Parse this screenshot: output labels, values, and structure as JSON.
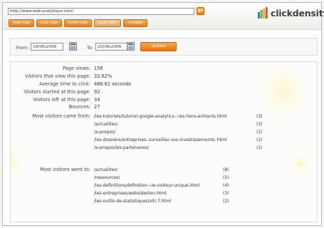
{
  "header": {
    "url": "http://www.web-analytique.com/",
    "go_label": "go",
    "tabs": [
      "heat map",
      "click map",
      "hover map",
      "page stats",
      "navigate"
    ],
    "active_tab_index": 3,
    "logo_text": "clickdensity"
  },
  "date_range": {
    "from_label": "From:",
    "from_value": "18/06/2006",
    "to_label": "To:",
    "to_value": "20/06/2006",
    "update_label": "update"
  },
  "stats": [
    {
      "label": "Page views:",
      "value": "156"
    },
    {
      "label": "Visitors that view this page:",
      "value": "32.62%"
    },
    {
      "label": "Average time to click:",
      "value": "466.61 seconds"
    },
    {
      "label": "Visitors started at this page:",
      "value": "92"
    },
    {
      "label": "Visitors left at this page:",
      "value": "34"
    },
    {
      "label": "Bounces:",
      "value": "27"
    }
  ],
  "came_from": {
    "label": "Most visitors came from:",
    "items": [
      {
        "path": "/les-tutoriels/tutoriel-google-analytics-:-les-liens-entrants.html",
        "count": "(3)"
      },
      {
        "path": "/actualites/",
        "count": "(3)"
      },
      {
        "path": "/a-propos/",
        "count": "(1)"
      },
      {
        "path": "/les-dossiers/entreprises,-surveillez-vos-investissements-.html",
        "count": "(1)"
      },
      {
        "path": "/a-propos/les-partenaires/",
        "count": "(1)"
      }
    ]
  },
  "went_to": {
    "label": "Most visitors went to:",
    "items": [
      {
        "path": "/actualites/",
        "count": "(8)"
      },
      {
        "path": "/ressources/",
        "count": "(5)"
      },
      {
        "path": "/les-definitions/definition-:-le-visiteur-unique.html",
        "count": "(4)"
      },
      {
        "path": "/les-entreprises/websideston.html",
        "count": "(3)"
      },
      {
        "path": "/les-outils-de-statistiques/xiti-7.html",
        "count": "(2)"
      }
    ]
  },
  "colors": {
    "accent": "#ef8416",
    "logo_stripes": [
      "#3e7fc7",
      "#6cb33f",
      "#f2b31b",
      "#e5502d"
    ]
  }
}
